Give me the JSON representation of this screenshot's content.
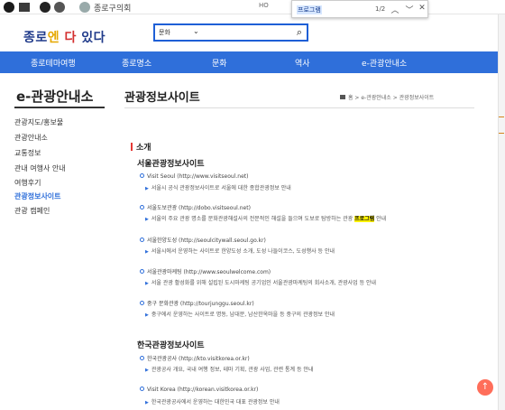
{
  "util": {
    "site_label": "종로구의회",
    "tab_fragment": "HO"
  },
  "find": {
    "query": "프로그램",
    "count": "1/2",
    "prev": "︿",
    "next": "﹀",
    "close": "✕"
  },
  "header": {
    "logo_a": "종로",
    "logo_b": "엔",
    "logo_c": " 다",
    "logo_d": " 있다",
    "search_select": "문화",
    "search_caret": "⌄",
    "search_icon": "⌕"
  },
  "nav": [
    "종로테마여행",
    "종로명소",
    "문화",
    "역사",
    "e-관광안내소"
  ],
  "sidebar": {
    "title": "e-관광안내소",
    "items": [
      {
        "label": "관광지도/홍보물",
        "active": false
      },
      {
        "label": "관광안내소",
        "active": false
      },
      {
        "label": "교통정보",
        "active": false
      },
      {
        "label": "관내 여행사 안내",
        "active": false
      },
      {
        "label": "여행후기",
        "active": false
      },
      {
        "label": "관광정보사이트",
        "active": true
      },
      {
        "label": "관광 캠페인",
        "active": false
      }
    ]
  },
  "main": {
    "title": "관광정보사이트",
    "breadcrumb": "홈 > e-관광안내소 > 관광정보사이트",
    "section": "소개",
    "groups": [
      {
        "title": "서울관광정보사이트",
        "items": [
          {
            "name": "Visit Seoul (http://www.visitseoul.net)",
            "desc": "서울시 공식 관광정보사이트로 서울에 대한 종합관광정보 안내"
          },
          {
            "name": "서울도보관광 (http://dobo.visitseoul.net)",
            "desc_pre": "서울의 주요 관광 명소를 문화관광해설사의 전문적인 해설을 들으며 도보로 탐방하는 관광 ",
            "desc_hl": "프로그램",
            "desc_post": " 안내"
          },
          {
            "name": "서울한양도성 (http://seoulcitywall.seoul.go.kr)",
            "desc": "서울시에서 운영하는 사이트로 한양도성 소개, 도성 나들이코스, 도성행사 등 안내"
          },
          {
            "name": "서울관광마케팅 (http://www.seoulwelcome.com)",
            "desc": "서울 관광 활성화를 위해 설립된 도시마케팅 공기업인 서울관광마케팅의 회사소개, 관광사업 등 안내"
          },
          {
            "name": "중구 문화관광 (http://tourjunggu.seoul.kr)",
            "desc": "중구에서 운영하는 사이트로 명동, 남대문, 남산한옥마을 등 중구의 관광정보 안내"
          }
        ]
      },
      {
        "title": "한국관광정보사이트",
        "items": [
          {
            "name": "한국관광공사 (http://kto.visitkorea.or.kr)",
            "desc": "관광공사 개요, 국내 여행 정보, 테마 기획, 관광 사업, 관련 통계 등 안내"
          },
          {
            "name": "Visit Korea (http://korean.visitkorea.or.kr)",
            "desc": "한국관광공사에서 운영하는 대한민국 대표 관광정보 안내"
          }
        ]
      }
    ]
  },
  "top_button": "↑",
  "colors": {
    "nav": "#2f6fda",
    "highlight": "#fff200",
    "top_button": "#ff6e5a",
    "logo": "#1f3a8a"
  }
}
